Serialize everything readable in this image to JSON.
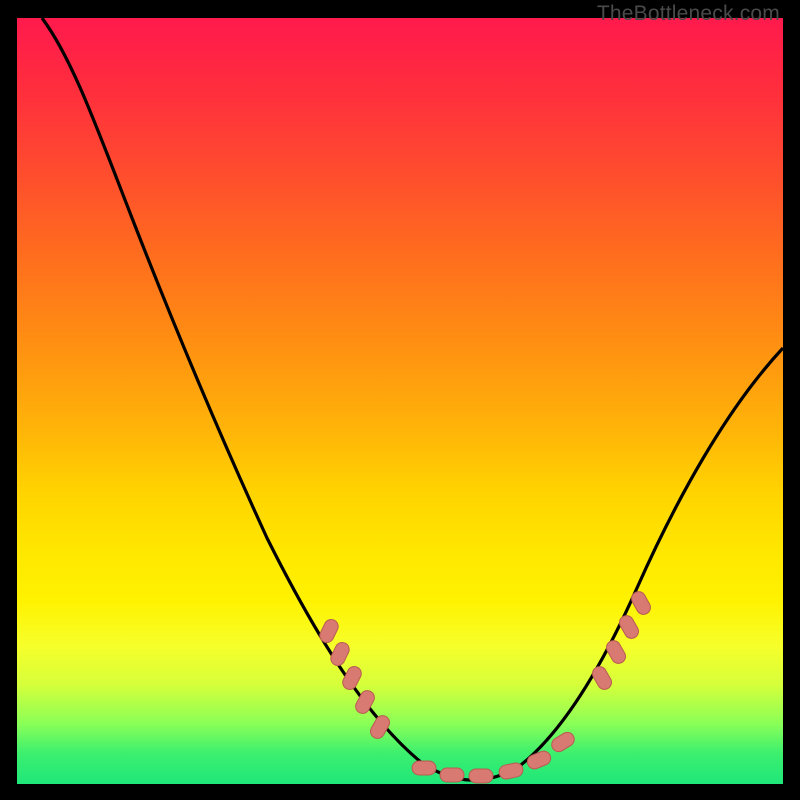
{
  "watermark": "TheBottleneck.com",
  "colors": {
    "background": "#000000",
    "curve": "#000000",
    "marker_fill": "#d97a72",
    "marker_stroke": "#b85a52"
  },
  "chart_data": {
    "type": "line",
    "title": "",
    "xlabel": "",
    "ylabel": "",
    "xlim": [
      0,
      100
    ],
    "ylim": [
      0,
      100
    ],
    "series": [
      {
        "name": "bottleneck-curve",
        "x": [
          0,
          5,
          10,
          15,
          20,
          25,
          30,
          35,
          40,
          45,
          50,
          55,
          58,
          60,
          63,
          66,
          70,
          75,
          80,
          85,
          90,
          95,
          100
        ],
        "y": [
          100,
          98,
          93,
          86,
          78,
          69,
          59,
          49,
          38,
          27,
          17,
          8,
          3,
          1,
          0,
          1,
          4,
          11,
          21,
          32,
          43,
          52,
          58
        ]
      }
    ],
    "markers": {
      "name": "highlight-points",
      "x": [
        41,
        43,
        45,
        47,
        50,
        56,
        58,
        61,
        63,
        65,
        67,
        69,
        75,
        77,
        79,
        81
      ],
      "y": [
        25,
        22,
        19,
        16,
        12,
        3,
        2,
        1,
        0,
        1,
        2,
        4,
        11,
        14,
        18,
        22
      ]
    },
    "gradient_meaning": "color encodes bottleneck severity: red=bad, green=good"
  }
}
